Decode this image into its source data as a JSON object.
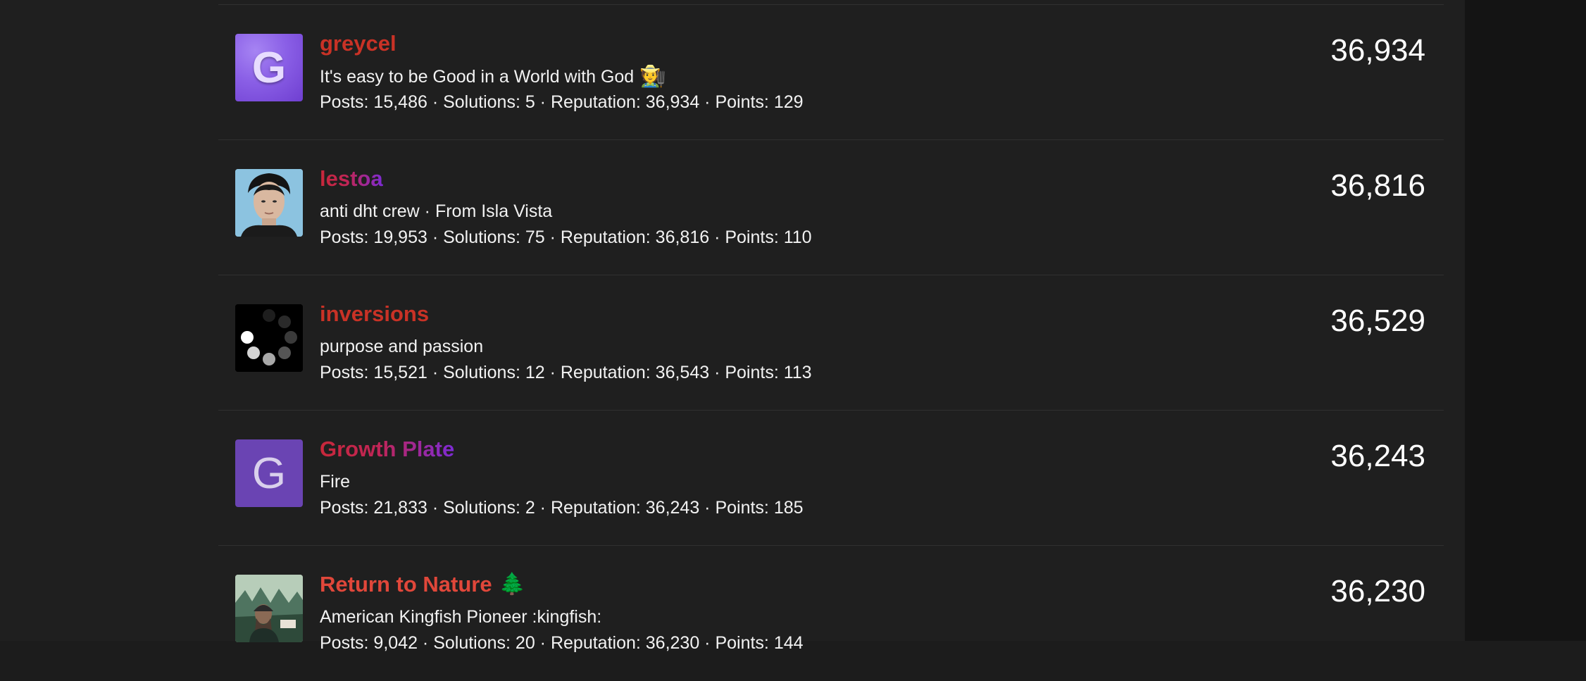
{
  "leaderboard": {
    "rows": [
      {
        "username": "greycel",
        "tagline": "It's easy to be Good in a World with God",
        "tagline_emoji": "🧑‍🌾",
        "stats": "Posts: 15,486 · Solutions: 5 · Reputation: 36,934 · Points: 129",
        "score": "36,934",
        "avatar_letter": "G"
      },
      {
        "username": "lestoa",
        "tagline": "anti dht crew · From Isla Vista",
        "stats": "Posts: 19,953 · Solutions: 75 · Reputation: 36,816 · Points: 110",
        "score": "36,816"
      },
      {
        "username": "inversions",
        "tagline": "purpose and passion",
        "stats": "Posts: 15,521 · Solutions: 12 · Reputation: 36,543 · Points: 113",
        "score": "36,529"
      },
      {
        "username": "Growth Plate",
        "tagline": "Fire",
        "stats": "Posts: 21,833 · Solutions: 2 · Reputation: 36,243 · Points: 185",
        "score": "36,243",
        "avatar_letter": "G"
      },
      {
        "username": "Return to Nature",
        "username_emoji": "🌲",
        "tagline": "American Kingfish Pioneer :kingfish:",
        "stats": "Posts: 9,042 · Solutions: 20 · Reputation: 36,230 · Points: 144",
        "score": "36,230"
      }
    ]
  },
  "colors": {
    "background": "#1f1f1f",
    "gutter": "#141414",
    "divider": "#303030",
    "username_red": "#c93226",
    "username_gradient_start": "#c7283a",
    "username_gradient_end": "#7d2bd6",
    "avatar_purple": "#6a44b3"
  },
  "icons": {
    "loading_avatar": "loading-spinner-icon"
  }
}
